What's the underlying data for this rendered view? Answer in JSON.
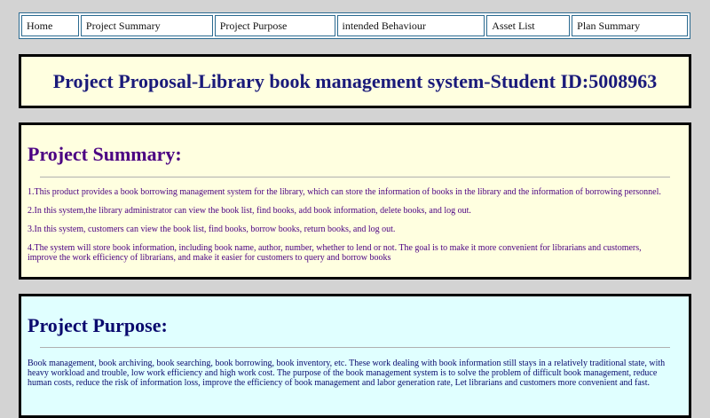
{
  "nav": {
    "items": [
      {
        "label": "Home"
      },
      {
        "label": "Project Summary"
      },
      {
        "label": "Project Purpose"
      },
      {
        "label": "intended Behaviour"
      },
      {
        "label": "Asset List"
      },
      {
        "label": "Plan Summary"
      }
    ]
  },
  "header": {
    "title": "Project Proposal-Library book management system-Student ID:5008963"
  },
  "summary": {
    "heading": "Project Summary:",
    "paragraphs": [
      "1.This product provides a book borrowing management system for the library, which can store the information of books in the library and the information of borrowing personnel.",
      "2.In this system,the library administrator can view the book list, find books, add book information, delete books, and log out.",
      "3.In this system, customers can view the book list, find books, borrow books, return books, and log out.",
      "4.The system will store book information, including book name, author, number, whether to lend or not. The goal is to make it more convenient for librarians and customers, improve the work efficiency of librarians, and make it easier for customers to query and borrow books"
    ]
  },
  "purpose": {
    "heading": "Project Purpose:",
    "paragraphs": [
      "Book management, book archiving, book searching, book borrowing, book inventory, etc. These work dealing with book information still stays in a relatively traditional state, with heavy workload and trouble, low work efficiency and high work cost. The purpose of the book management system is to solve the problem of difficult book management, reduce human costs, reduce the risk of information loss, improve the efficiency of book management and labor generation rate, Let librarians and customers more convenient and fast."
    ]
  }
}
